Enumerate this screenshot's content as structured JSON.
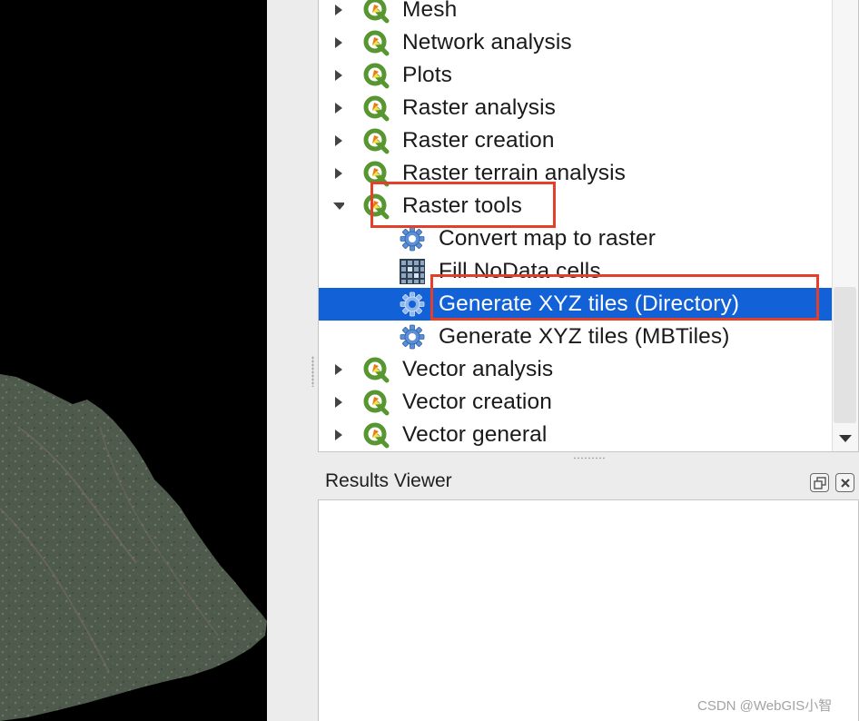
{
  "toolbox": {
    "groups_top": [
      {
        "label": "Mesh"
      },
      {
        "label": "Network analysis"
      },
      {
        "label": "Plots"
      },
      {
        "label": "Raster analysis"
      },
      {
        "label": "Raster creation"
      },
      {
        "label": "Raster terrain analysis"
      }
    ],
    "expanded_group": {
      "label": "Raster tools",
      "children": [
        {
          "label": "Convert map to raster",
          "icon": "gear-icon"
        },
        {
          "label": "Fill NoData cells",
          "icon": "grid-icon"
        },
        {
          "label": "Generate XYZ tiles (Directory)",
          "icon": "gear-icon",
          "selected": true
        },
        {
          "label": "Generate XYZ tiles (MBTiles)",
          "icon": "gear-icon"
        }
      ]
    },
    "groups_bottom": [
      {
        "label": "Vector analysis"
      },
      {
        "label": "Vector creation"
      },
      {
        "label": "Vector general"
      }
    ]
  },
  "results_viewer": {
    "title": "Results Viewer"
  },
  "watermark": "CSDN @WebGIS小智",
  "colors": {
    "selection": "#1261d6",
    "annotation": "#e2402a",
    "qgis_green": "#589632",
    "qgis_orange": "#ee7913"
  }
}
